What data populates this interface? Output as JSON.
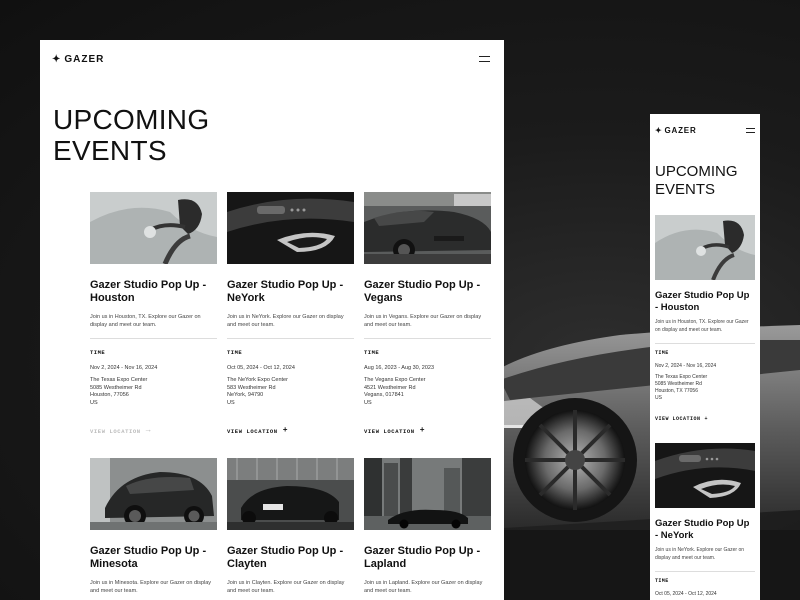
{
  "brand": {
    "star": "✦",
    "name": "GAZER"
  },
  "desktop": {
    "title": "UPCOMING EVENTS",
    "time_label": "TIME",
    "view_location_label": "VIEW LOCATION",
    "cards": [
      {
        "title": "Gazer Studio Pop Up - Houston",
        "desc": "Join us in Houston, TX. Explore our Gazer on display and meet our team.",
        "dates": "Nov 2, 2024 - Nov 16, 2024",
        "venue": "The Texas Expo Center",
        "street": "5085 Westheimer Rd",
        "city": "Houston, 77056",
        "country": "US",
        "image": "ev-charger-photo"
      },
      {
        "title": "Gazer Studio Pop Up - NeYork",
        "desc": "Join us in NeYork. Explore our Gazer on display and meet our team.",
        "dates": "Oct 05, 2024 - Oct 12, 2024",
        "venue": "The NeYork Expo Center",
        "street": "583 Westheimer Rd",
        "city": "NeYork, 94790",
        "country": "US",
        "image": "car-door-interior-photo"
      },
      {
        "title": "Gazer Studio Pop Up - Vegans",
        "desc": "Join us in Vegans. Explore our Gazer on display and meet our team.",
        "dates": "Aug 16, 2023 - Aug 30, 2023",
        "venue": "The Vegans Expo Center",
        "street": "4521 Westheimer Rd",
        "city": "Vegans, 017841",
        "country": "US",
        "image": "sports-car-photo"
      },
      {
        "title": "Gazer Studio Pop Up - Minesota",
        "desc": "Join us in Minesota. Explore our Gazer on display and meet our team.",
        "image": "suv-charging-photo"
      },
      {
        "title": "Gazer Studio Pop Up - Clayten",
        "desc": "Join us in Clayten. Explore our Gazer on display and meet our team.",
        "image": "showroom-car-photo"
      },
      {
        "title": "Gazer Studio Pop Up - Lapland",
        "desc": "Join us in Lapland. Explore our Gazer on display and meet our team.",
        "image": "city-sedan-photo"
      }
    ]
  },
  "mobile": {
    "title": "UPCOMING EVENTS",
    "time_label": "TIME",
    "view_location_label": "VIEW LOCATION",
    "cards": [
      {
        "title": "Gazer Studio Pop Up - Houston",
        "desc": "Join us in Houston, TX. Explore our Gazer on display and meet our team.",
        "dates": "Nov 2, 2024 - Nov 16, 2024",
        "venue": "The Texas Expo Center",
        "street": "5085 Westheimer Rd",
        "city": "Houston, TX 77056",
        "country": "US"
      },
      {
        "title": "Gazer Studio Pop Up - NeYork",
        "desc": "Join us in NeYork. Explore our Gazer on display and meet our team.",
        "dates": "Oct 05, 2024 - Oct 12, 2024"
      }
    ]
  },
  "colors": {
    "background": "#141414",
    "panel": "#ffffff",
    "text": "#111111",
    "muted": "#bbbbbb"
  }
}
